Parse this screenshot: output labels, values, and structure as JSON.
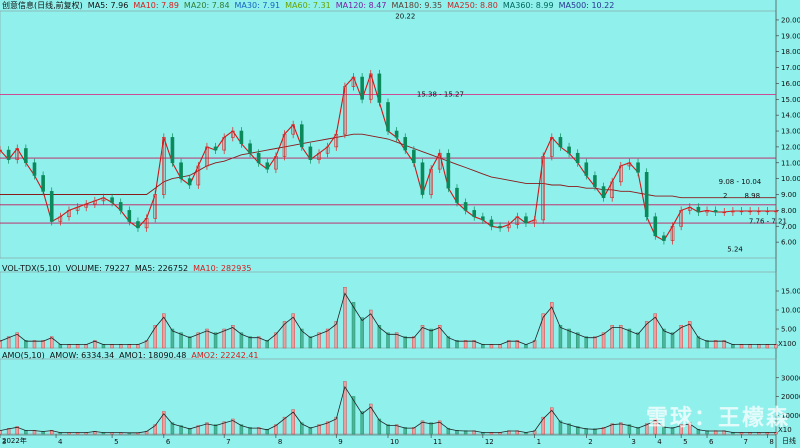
{
  "panels": {
    "main": {
      "legend": [
        {
          "text": "创意信息(日线,前复权)",
          "color": "#111111"
        },
        {
          "text": "MA5: 7.96",
          "color": "#111111"
        },
        {
          "text": "MA10: 7.89",
          "color": "#d81b1b"
        },
        {
          "text": "MA20: 7.84",
          "color": "#2e7d32"
        },
        {
          "text": "MA30: 7.91",
          "color": "#1565c0"
        },
        {
          "text": "MA60: 7.31",
          "color": "#6aa300"
        },
        {
          "text": "MA120: 8.47",
          "color": "#7b1fa2"
        },
        {
          "text": "MA180: 9.35",
          "color": "#5d4037"
        },
        {
          "text": "MA250: 8.80",
          "color": "#c62828"
        },
        {
          "text": "MA360: 8.99",
          "color": "#00695c"
        },
        {
          "text": "MA500: 10.22",
          "color": "#283593"
        }
      ],
      "annotations": [
        {
          "text": "20.22",
          "x": 91,
          "y": 20.22
        },
        {
          "text": "15.38 - 15.27",
          "x": 96,
          "y": 15.3
        },
        {
          "text": "9.08 - 10.04",
          "x": 166,
          "y": 9.8
        },
        {
          "text": "7.76 - 7.21",
          "x": 173,
          "y": 7.3
        },
        {
          "text": "5.24",
          "x": 168,
          "y": 5.55
        },
        {
          "text": "8.98",
          "x": 172,
          "y": 8.9
        },
        {
          "text": "2",
          "x": 167,
          "y": 8.9
        }
      ]
    },
    "volume": {
      "legend": [
        {
          "text": "VOL-TDX(5,10)",
          "color": "#111111"
        },
        {
          "text": "VOLUME: 79227",
          "color": "#111111"
        },
        {
          "text": "MA5: 226752",
          "color": "#111111"
        },
        {
          "text": "MA10: 282935",
          "color": "#d81b1b"
        }
      ],
      "unit": "X100"
    },
    "amount": {
      "legend": [
        {
          "text": "AMO(5,10)",
          "color": "#111111"
        },
        {
          "text": "AMOW: 6334.34",
          "color": "#111111"
        },
        {
          "text": "AMO1: 18090.48",
          "color": "#111111"
        },
        {
          "text": "AMO2: 22242.41",
          "color": "#d81b1b"
        }
      ],
      "unit": "X10"
    }
  },
  "axis": {
    "year_label": "2022年",
    "end_label": "日线"
  },
  "watermark": "雪球：王檬森",
  "chart_data": [
    {
      "type": "line",
      "title": "创意信息(日线,前复权)",
      "x": [
        0,
        2,
        4,
        6,
        8,
        10,
        12,
        14,
        16,
        18,
        20,
        22,
        24,
        26,
        28,
        30,
        32,
        34,
        36,
        38,
        40,
        42,
        44,
        46,
        48,
        50,
        52,
        54,
        56,
        58,
        60,
        62,
        64,
        66,
        68,
        70,
        72,
        74,
        76,
        78,
        80,
        82,
        84,
        86,
        88,
        90,
        92,
        94,
        96,
        98,
        100,
        102,
        104,
        106,
        108,
        110,
        112,
        114,
        116,
        118,
        120,
        122,
        124,
        126,
        128,
        130,
        132,
        134,
        136,
        138,
        140,
        142,
        144,
        146,
        148,
        150,
        152,
        154,
        156,
        158,
        160,
        162,
        164,
        166,
        168,
        170,
        172,
        174,
        176,
        178,
        180
      ],
      "series": [
        {
          "name": "Close",
          "values": [
            11.8,
            11.2,
            11.9,
            11.0,
            10.2,
            9.2,
            7.3,
            7.6,
            8.0,
            8.2,
            8.4,
            8.6,
            8.8,
            8.5,
            8.0,
            7.3,
            6.9,
            7.5,
            9.0,
            12.6,
            11.0,
            10.0,
            9.6,
            10.8,
            12.0,
            11.8,
            12.6,
            13.0,
            12.2,
            11.6,
            11.0,
            10.6,
            11.4,
            12.8,
            13.4,
            12.0,
            11.2,
            11.6,
            12.0,
            12.8,
            15.8,
            16.4,
            15.0,
            16.6,
            14.8,
            13.0,
            12.6,
            11.8,
            11.0,
            9.0,
            10.6,
            11.6,
            9.4,
            8.5,
            8.0,
            7.6,
            7.4,
            7.0,
            6.9,
            7.1,
            7.6,
            7.2,
            7.4,
            11.4,
            12.6,
            12.0,
            11.6,
            11.0,
            10.2,
            9.5,
            8.8,
            9.8,
            10.8,
            11.0,
            10.4,
            7.6,
            6.4,
            6.1,
            7.0,
            8.0,
            8.2,
            7.9,
            8.0,
            7.9,
            7.9,
            7.96,
            7.96,
            7.96,
            7.96,
            7.96,
            7.96
          ]
        },
        {
          "name": "MA250",
          "values": [
            9.0,
            9.0,
            9.0,
            9.0,
            9.0,
            9.0,
            9.0,
            9.0,
            9.0,
            9.0,
            9.0,
            9.0,
            9.0,
            9.0,
            9.0,
            9.0,
            9.0,
            9.0,
            9.4,
            9.8,
            10.0,
            10.1,
            10.2,
            10.5,
            10.8,
            11.0,
            11.1,
            11.3,
            11.5,
            11.6,
            11.7,
            11.8,
            11.9,
            12.0,
            12.1,
            12.2,
            12.3,
            12.4,
            12.5,
            12.6,
            12.7,
            12.8,
            12.8,
            12.7,
            12.6,
            12.5,
            12.3,
            12.1,
            11.9,
            11.7,
            11.5,
            11.3,
            11.1,
            10.9,
            10.7,
            10.5,
            10.3,
            10.1,
            10.0,
            9.9,
            9.8,
            9.7,
            9.7,
            9.7,
            9.6,
            9.6,
            9.5,
            9.5,
            9.4,
            9.4,
            9.3,
            9.3,
            9.2,
            9.2,
            9.1,
            9.0,
            8.9,
            8.9,
            8.9,
            8.8,
            8.8,
            8.8,
            8.8,
            8.8,
            8.8,
            8.8,
            8.8,
            8.8,
            8.8,
            8.8,
            8.8
          ]
        }
      ],
      "ylim": [
        5,
        20.5
      ],
      "xlabel": "",
      "ylabel": "",
      "y_ticks": [
        6.0,
        7.0,
        8.0,
        9.0,
        10.0,
        11.0,
        12.0,
        13.0,
        14.0,
        15.0,
        16.0,
        17.0,
        18.0,
        19.0,
        20.0
      ],
      "hlines": [
        15.3,
        11.3,
        8.35,
        7.2
      ],
      "x_tick_labels": [
        {
          "x": 0,
          "label": "3"
        },
        {
          "x": 13,
          "label": "4"
        },
        {
          "x": 26,
          "label": "5"
        },
        {
          "x": 38,
          "label": "6"
        },
        {
          "x": 52,
          "label": "7"
        },
        {
          "x": 64,
          "label": "8"
        },
        {
          "x": 78,
          "label": "9"
        },
        {
          "x": 90,
          "label": "10"
        },
        {
          "x": 100,
          "label": "11"
        },
        {
          "x": 112,
          "label": "12"
        },
        {
          "x": 124,
          "label": "1"
        },
        {
          "x": 136,
          "label": "2"
        },
        {
          "x": 146,
          "label": "3"
        },
        {
          "x": 152,
          "label": "4"
        },
        {
          "x": 158,
          "label": "5"
        },
        {
          "x": 164,
          "label": "6"
        },
        {
          "x": 172,
          "label": "7"
        },
        {
          "x": 178,
          "label": "8"
        }
      ]
    },
    {
      "type": "bar",
      "title": "VOL-TDX(5,10)",
      "x": [
        0,
        2,
        4,
        6,
        8,
        10,
        12,
        14,
        16,
        18,
        20,
        22,
        24,
        26,
        28,
        30,
        32,
        34,
        36,
        38,
        40,
        42,
        44,
        46,
        48,
        50,
        52,
        54,
        56,
        58,
        60,
        62,
        64,
        66,
        68,
        70,
        72,
        74,
        76,
        78,
        80,
        82,
        84,
        86,
        88,
        90,
        92,
        94,
        96,
        98,
        100,
        102,
        104,
        106,
        108,
        110,
        112,
        114,
        116,
        118,
        120,
        122,
        124,
        126,
        128,
        130,
        132,
        134,
        136,
        138,
        140,
        142,
        144,
        146,
        148,
        150,
        152,
        154,
        156,
        158,
        160,
        162,
        164,
        166,
        168,
        170,
        172,
        174,
        176,
        178,
        180
      ],
      "values": [
        2,
        3,
        4,
        2,
        2,
        2,
        3,
        1,
        1,
        1,
        1,
        2,
        1,
        1,
        1,
        1,
        1,
        2,
        6,
        9,
        5,
        4,
        3,
        4,
        5,
        4,
        5,
        6,
        4,
        3,
        3,
        2,
        4,
        7,
        9,
        5,
        3,
        4,
        5,
        7,
        16,
        12,
        8,
        10,
        6,
        4,
        4,
        3,
        3,
        6,
        5,
        6,
        3,
        2,
        2,
        2,
        1,
        1,
        1,
        2,
        2,
        1,
        2,
        9,
        12,
        6,
        5,
        4,
        3,
        3,
        4,
        6,
        6,
        5,
        4,
        7,
        9,
        5,
        4,
        6,
        7,
        3,
        2,
        2,
        2,
        1,
        1,
        1,
        1,
        1,
        1
      ],
      "ylim": [
        0,
        20
      ],
      "xlabel": "",
      "ylabel": "",
      "y_ticks": [
        5.0,
        10.0,
        15.0
      ]
    },
    {
      "type": "bar",
      "title": "AMO(5,10)",
      "x": [
        0,
        2,
        4,
        6,
        8,
        10,
        12,
        14,
        16,
        18,
        20,
        22,
        24,
        26,
        28,
        30,
        32,
        34,
        36,
        38,
        40,
        42,
        44,
        46,
        48,
        50,
        52,
        54,
        56,
        58,
        60,
        62,
        64,
        66,
        68,
        70,
        72,
        74,
        76,
        78,
        80,
        82,
        84,
        86,
        88,
        90,
        92,
        94,
        96,
        98,
        100,
        102,
        104,
        106,
        108,
        110,
        112,
        114,
        116,
        118,
        120,
        122,
        124,
        126,
        128,
        130,
        132,
        134,
        136,
        138,
        140,
        142,
        144,
        146,
        148,
        150,
        152,
        154,
        156,
        158,
        160,
        162,
        164,
        166,
        168,
        170,
        172,
        174,
        176,
        178,
        180
      ],
      "values": [
        2000,
        3000,
        4000,
        2000,
        2000,
        1500,
        2000,
        800,
        800,
        800,
        800,
        1500,
        800,
        800,
        800,
        700,
        700,
        1500,
        5000,
        12000,
        6000,
        4500,
        3000,
        4500,
        6000,
        5000,
        6500,
        8000,
        5000,
        3500,
        3500,
        2500,
        5000,
        9000,
        13000,
        6000,
        3500,
        5000,
        6500,
        9000,
        28000,
        20000,
        12000,
        16000,
        8000,
        5000,
        5000,
        3500,
        3500,
        7000,
        6000,
        7000,
        3000,
        2000,
        1800,
        1800,
        900,
        900,
        900,
        1800,
        1800,
        900,
        1800,
        9000,
        14000,
        7000,
        5500,
        4000,
        3000,
        2800,
        3500,
        5500,
        6000,
        5000,
        3500,
        5500,
        8000,
        4000,
        3500,
        5000,
        6000,
        2500,
        1800,
        1800,
        1800,
        900,
        900,
        900,
        900,
        900,
        900
      ],
      "ylim": [
        0,
        40000
      ],
      "xlabel": "",
      "ylabel": "",
      "y_ticks": [
        10000.0,
        20000.0,
        30000.0
      ]
    }
  ]
}
